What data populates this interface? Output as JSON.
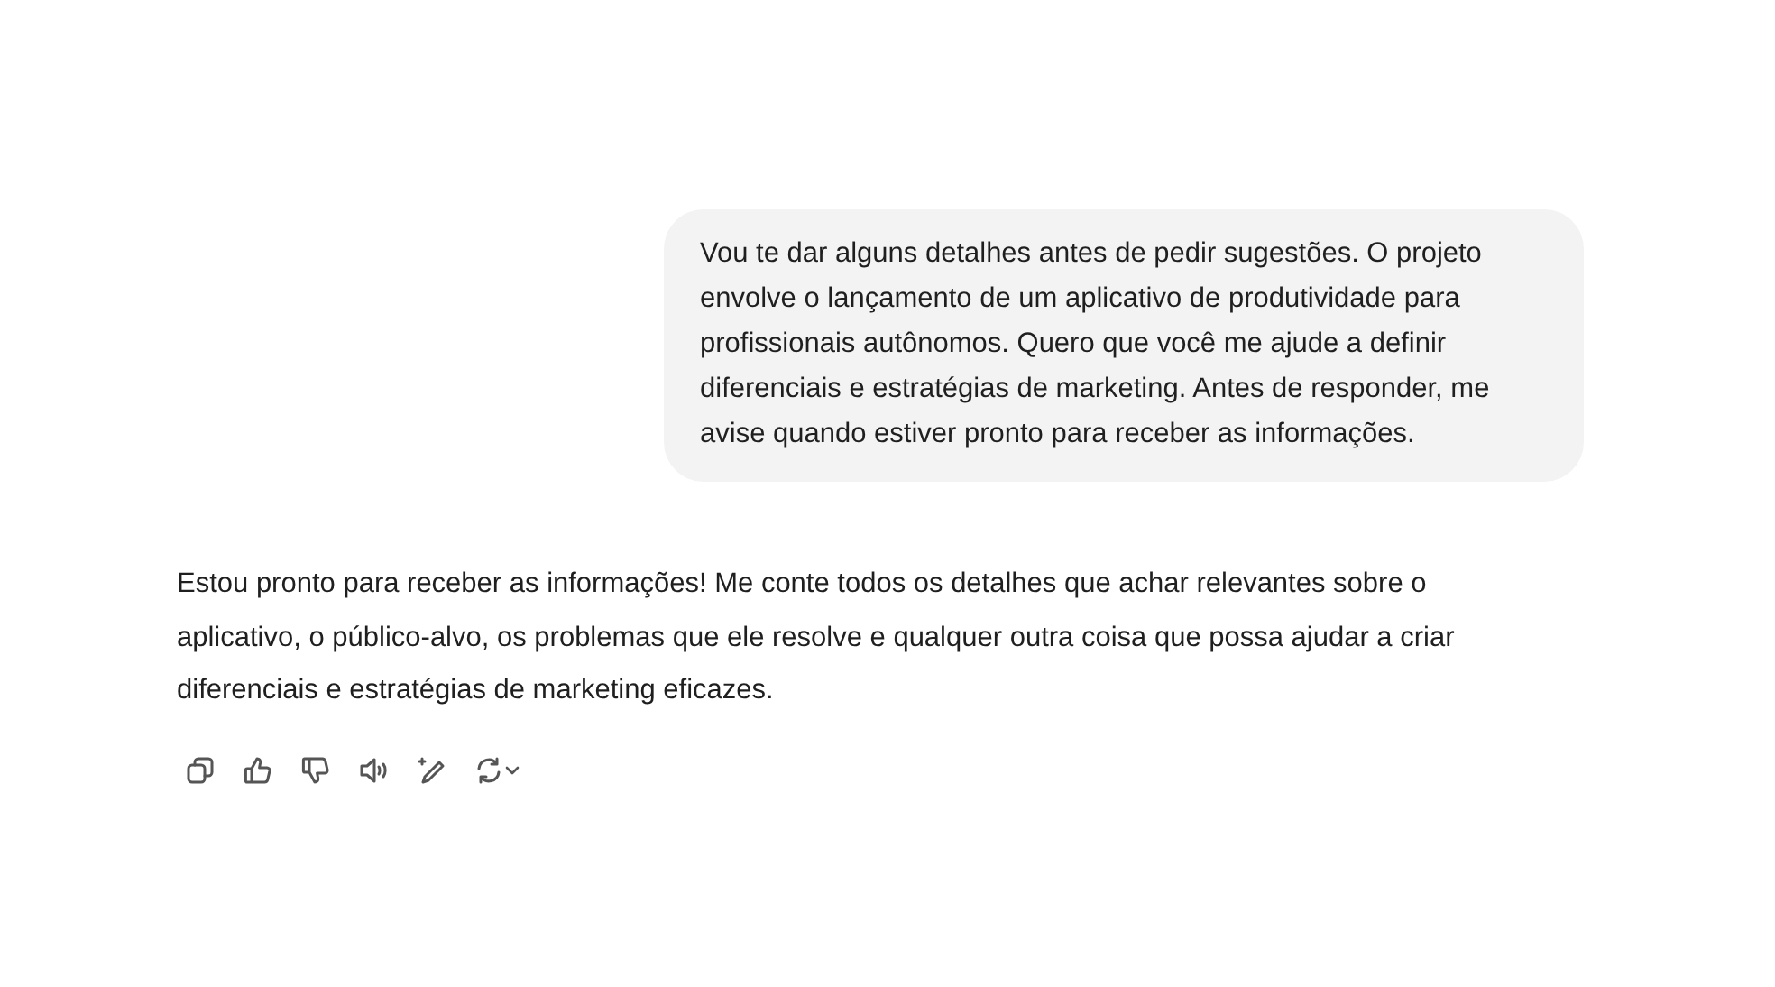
{
  "user_message": {
    "text": "Vou te dar alguns detalhes antes de pedir sugestões. O projeto envolve o lançamento de um aplicativo de produtividade para profissionais autônomos. Quero que você me ajude a definir diferenciais e estratégias de marketing. Antes de responder, me avise quando estiver pronto para receber as informações."
  },
  "assistant_message": {
    "text": "Estou pronto para receber as informações! Me conte todos os detalhes que achar relevantes sobre o aplicativo, o público-alvo, os problemas que ele resolve e qualquer outra coisa que possa ajudar a criar diferenciais e estratégias de marketing eficazes."
  }
}
